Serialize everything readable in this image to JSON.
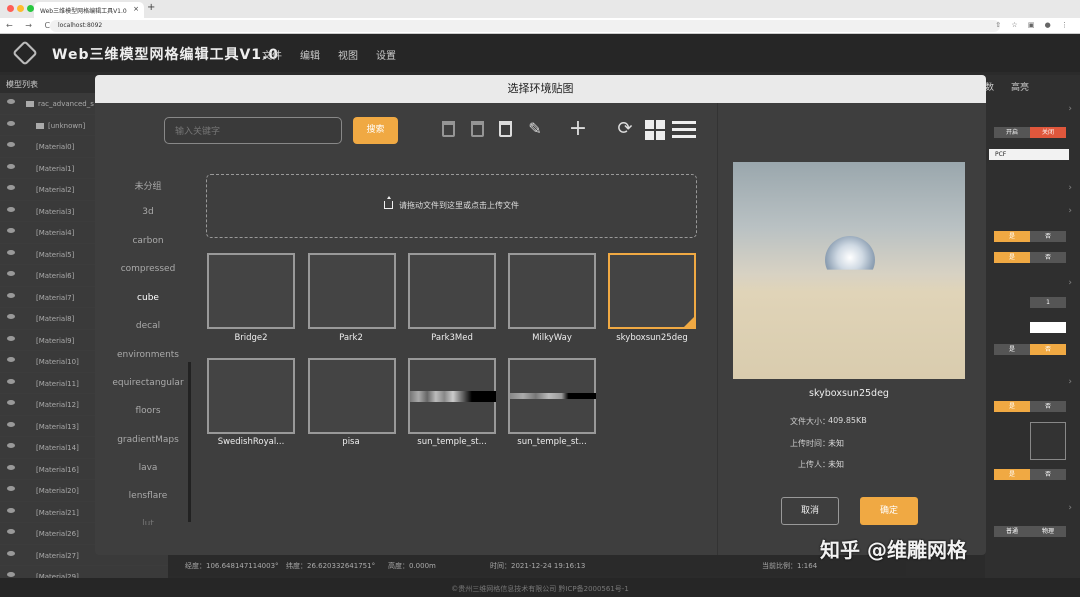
{
  "browser": {
    "tab_title": "Web三维模型网格编辑工具V1.0",
    "tab_close": "×",
    "new_tab": "+",
    "nav": "← → C",
    "url": "localhost:8092",
    "right_icons": "⇧ ☆ ▣ ● ⋮"
  },
  "app": {
    "title": "Web三维模型网格编辑工具V1.0",
    "menu": [
      "文件",
      "编辑",
      "视图",
      "设置"
    ]
  },
  "left_panel": {
    "title": "模型列表",
    "root": "rac_advanced_s",
    "unknown": "[unknown]",
    "items": [
      "[Material0]",
      "[Material1]",
      "[Material2]",
      "[Material3]",
      "[Material4]",
      "[Material5]",
      "[Material6]",
      "[Material7]",
      "[Material8]",
      "[Material9]",
      "[Material10]",
      "[Material11]",
      "[Material12]",
      "[Material13]",
      "[Material14]",
      "[Material16]",
      "[Material20]",
      "[Material21]",
      "[Material26]",
      "[Material27]",
      "[Material29]"
    ]
  },
  "right_panel": {
    "tab_partial": "数",
    "tab_highlight": "高亮",
    "btn_on": "开启",
    "btn_off": "关闭",
    "select_value": "PCF",
    "yes": "是",
    "no": "否",
    "input_value": "1",
    "normal": "普通",
    "physical": "物理"
  },
  "modal": {
    "title": "选择环境贴图",
    "search_placeholder": "输入关键字",
    "search_button": "搜索",
    "categories": [
      "未分组",
      "3d",
      "carbon",
      "compressed",
      "cube",
      "decal",
      "environments",
      "equirectangular",
      "floors",
      "gradientMaps",
      "lava",
      "lensflare",
      "lut"
    ],
    "active_category": "cube",
    "upload_text": "请拖动文件到这里或点击上传文件",
    "items": [
      {
        "name": "Bridge2"
      },
      {
        "name": "Park2"
      },
      {
        "name": "Park3Med"
      },
      {
        "name": "MilkyWay"
      },
      {
        "name": "skyboxsun25deg"
      },
      {
        "name": "SwedishRoyal..."
      },
      {
        "name": "pisa"
      },
      {
        "name": "sun_temple_st..."
      },
      {
        "name": "sun_temple_st..."
      }
    ],
    "preview": {
      "name": "skyboxsun25deg",
      "size_label": "文件大小：",
      "size": "409.85KB",
      "time_label": "上传时间：",
      "time": "未知",
      "uploader_label": "上传人：",
      "uploader": "未知"
    },
    "cancel": "取消",
    "confirm": "确定"
  },
  "status": {
    "lon": "经度：106.648147114003°",
    "lat": "纬度：26.620332641751°",
    "alt": "高度：0.000m",
    "time": "时间：2021-12-24 19:16:13",
    "scale": "当前比例：1:164"
  },
  "footer": "©贵州三维网格信息技术有限公司  黔ICP备2000561号-1",
  "watermark": "知乎 @维雕网格",
  "colors": {
    "accent": "#f0a943",
    "btn_red": "#e0573c",
    "btn_grey": "#555555"
  }
}
